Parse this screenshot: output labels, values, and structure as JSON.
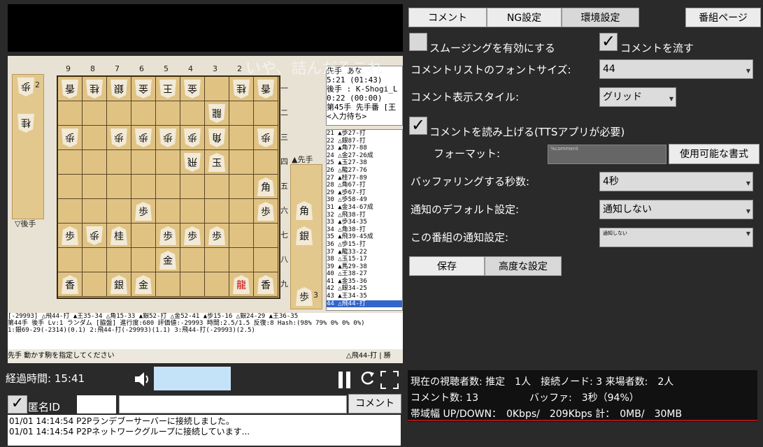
{
  "board": {
    "overlay_comment": "いや、詰んだろこれ",
    "file_labels": [
      "9",
      "8",
      "7",
      "6",
      "5",
      "4",
      "3",
      "2"
    ],
    "rank_labels": [
      "一",
      "二",
      "三",
      "四",
      "五",
      "六",
      "七",
      "八",
      "九"
    ],
    "gote_stand_label": "▽後手",
    "sente_stand_label": "▲先手",
    "gote_hand": [
      "歩",
      "桂"
    ],
    "gote_hand_count": "2",
    "sente_hand": [
      "角",
      "銀",
      "歩"
    ],
    "sente_hand_count": "3",
    "info_lines": [
      "先手 あな",
      "5:21 (01:43)",
      "後手 : K-Shogi_L",
      "0:22 (00:00)",
      "第45手 先手番 [王",
      "<入力待ち>"
    ],
    "moves": [
      "21 ▲歩27-打",
      "22 △銀87-打",
      "23 ▲角77-88",
      "24 △金27-26成",
      "25 ▲玉27-38",
      "26 △龍27-76",
      "27 ▲桂77-89",
      "28 △角67-打",
      "29 ▲歩67-打",
      "30 △歩58-49",
      "31 ▲金34-67成",
      "32 △飛38-打",
      "33 ▲歩34-35",
      "34 △角38-打",
      "35 ▲飛39-45成",
      "36 △歩15-打",
      "37 ▲龍33-22",
      "38 △玉15-17",
      "39 ▲馬29-38",
      "40 △王38-27",
      "41 ▲金35-36",
      "42 △銀34-25",
      "43 ▲王34-35",
      "44 △飛44-打"
    ],
    "status_lines": [
      "[-29993] △飛44-打 ▲王35-34 △角15-33 ▲銀52-打 △金52-41 ▲歩15-16 △銀24-29 ▲王36-35",
      "第44手 後手 Lv:1 ランダム [脇盤] 進行度:680 評価値:-29993 時間:2.5/1.5 反復:8 Hash:(98% 79% 0% 0% 0%)",
      "1:銀69-29(-2314)(0.1) 2:飛44-打(-29993)(1.1) 3:飛44-打(-29993)(2.5)"
    ],
    "footer_text": "先手 動かす駒を指定してください",
    "footer_right": "△飛44-打 | 勝"
  },
  "controls": {
    "elapsed": "経過時間: 15:41",
    "anon_label": "匿名ID",
    "comment_button": "コメント",
    "log": [
      "01/01 14:14:54 P2Pランデブーサーバーに接続しました。",
      "01/01 14:14:54 P2Pネットワークグループに接続しています..."
    ]
  },
  "tabs": {
    "comment": "コメント",
    "ng": "NG設定",
    "env": "環境設定",
    "program": "番組ページ"
  },
  "settings": {
    "smoothing": "スムージングを有効にする",
    "flow_comments": "コメントを流す",
    "font_size_label": "コメントリストのフォントサイズ:",
    "font_size_value": "44",
    "style_label": "コメント表示スタイル:",
    "style_value": "グリッド",
    "tts": "コメントを読み上げる(TTSアプリが必要)",
    "format_label": "フォーマット:",
    "format_value": "%comment",
    "format_button": "使用可能な書式",
    "buffer_label": "バッファリングする秒数:",
    "buffer_value": "4秒",
    "notify_default_label": "通知のデフォルト設定:",
    "notify_default_value": "通知しない",
    "notify_program_label": "この番組の通知設定:",
    "notify_program_value": "通知しない",
    "save_button": "保存",
    "advanced_button": "高度な設定"
  },
  "stats": {
    "line1": "現在の視聴者数: 推定　1人　接続ノード: 3 来場者数:　2人",
    "line2a": "コメント数: 13",
    "line2b": "バッファ:　3秒（94%）",
    "line3": "帯域幅 UP/DOWN：　0Kbps/　209Kbps 計：　0MB/　30MB"
  }
}
